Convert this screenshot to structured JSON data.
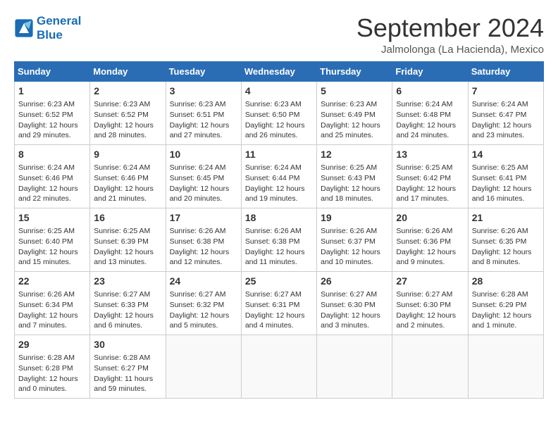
{
  "header": {
    "logo_line1": "General",
    "logo_line2": "Blue",
    "month": "September 2024",
    "location": "Jalmolonga (La Hacienda), Mexico"
  },
  "days_of_week": [
    "Sunday",
    "Monday",
    "Tuesday",
    "Wednesday",
    "Thursday",
    "Friday",
    "Saturday"
  ],
  "weeks": [
    [
      {
        "num": "1",
        "info": "Sunrise: 6:23 AM\nSunset: 6:52 PM\nDaylight: 12 hours\nand 29 minutes."
      },
      {
        "num": "2",
        "info": "Sunrise: 6:23 AM\nSunset: 6:52 PM\nDaylight: 12 hours\nand 28 minutes."
      },
      {
        "num": "3",
        "info": "Sunrise: 6:23 AM\nSunset: 6:51 PM\nDaylight: 12 hours\nand 27 minutes."
      },
      {
        "num": "4",
        "info": "Sunrise: 6:23 AM\nSunset: 6:50 PM\nDaylight: 12 hours\nand 26 minutes."
      },
      {
        "num": "5",
        "info": "Sunrise: 6:23 AM\nSunset: 6:49 PM\nDaylight: 12 hours\nand 25 minutes."
      },
      {
        "num": "6",
        "info": "Sunrise: 6:24 AM\nSunset: 6:48 PM\nDaylight: 12 hours\nand 24 minutes."
      },
      {
        "num": "7",
        "info": "Sunrise: 6:24 AM\nSunset: 6:47 PM\nDaylight: 12 hours\nand 23 minutes."
      }
    ],
    [
      {
        "num": "8",
        "info": "Sunrise: 6:24 AM\nSunset: 6:46 PM\nDaylight: 12 hours\nand 22 minutes."
      },
      {
        "num": "9",
        "info": "Sunrise: 6:24 AM\nSunset: 6:46 PM\nDaylight: 12 hours\nand 21 minutes."
      },
      {
        "num": "10",
        "info": "Sunrise: 6:24 AM\nSunset: 6:45 PM\nDaylight: 12 hours\nand 20 minutes."
      },
      {
        "num": "11",
        "info": "Sunrise: 6:24 AM\nSunset: 6:44 PM\nDaylight: 12 hours\nand 19 minutes."
      },
      {
        "num": "12",
        "info": "Sunrise: 6:25 AM\nSunset: 6:43 PM\nDaylight: 12 hours\nand 18 minutes."
      },
      {
        "num": "13",
        "info": "Sunrise: 6:25 AM\nSunset: 6:42 PM\nDaylight: 12 hours\nand 17 minutes."
      },
      {
        "num": "14",
        "info": "Sunrise: 6:25 AM\nSunset: 6:41 PM\nDaylight: 12 hours\nand 16 minutes."
      }
    ],
    [
      {
        "num": "15",
        "info": "Sunrise: 6:25 AM\nSunset: 6:40 PM\nDaylight: 12 hours\nand 15 minutes."
      },
      {
        "num": "16",
        "info": "Sunrise: 6:25 AM\nSunset: 6:39 PM\nDaylight: 12 hours\nand 13 minutes."
      },
      {
        "num": "17",
        "info": "Sunrise: 6:26 AM\nSunset: 6:38 PM\nDaylight: 12 hours\nand 12 minutes."
      },
      {
        "num": "18",
        "info": "Sunrise: 6:26 AM\nSunset: 6:38 PM\nDaylight: 12 hours\nand 11 minutes."
      },
      {
        "num": "19",
        "info": "Sunrise: 6:26 AM\nSunset: 6:37 PM\nDaylight: 12 hours\nand 10 minutes."
      },
      {
        "num": "20",
        "info": "Sunrise: 6:26 AM\nSunset: 6:36 PM\nDaylight: 12 hours\nand 9 minutes."
      },
      {
        "num": "21",
        "info": "Sunrise: 6:26 AM\nSunset: 6:35 PM\nDaylight: 12 hours\nand 8 minutes."
      }
    ],
    [
      {
        "num": "22",
        "info": "Sunrise: 6:26 AM\nSunset: 6:34 PM\nDaylight: 12 hours\nand 7 minutes."
      },
      {
        "num": "23",
        "info": "Sunrise: 6:27 AM\nSunset: 6:33 PM\nDaylight: 12 hours\nand 6 minutes."
      },
      {
        "num": "24",
        "info": "Sunrise: 6:27 AM\nSunset: 6:32 PM\nDaylight: 12 hours\nand 5 minutes."
      },
      {
        "num": "25",
        "info": "Sunrise: 6:27 AM\nSunset: 6:31 PM\nDaylight: 12 hours\nand 4 minutes."
      },
      {
        "num": "26",
        "info": "Sunrise: 6:27 AM\nSunset: 6:30 PM\nDaylight: 12 hours\nand 3 minutes."
      },
      {
        "num": "27",
        "info": "Sunrise: 6:27 AM\nSunset: 6:30 PM\nDaylight: 12 hours\nand 2 minutes."
      },
      {
        "num": "28",
        "info": "Sunrise: 6:28 AM\nSunset: 6:29 PM\nDaylight: 12 hours\nand 1 minute."
      }
    ],
    [
      {
        "num": "29",
        "info": "Sunrise: 6:28 AM\nSunset: 6:28 PM\nDaylight: 12 hours\nand 0 minutes."
      },
      {
        "num": "30",
        "info": "Sunrise: 6:28 AM\nSunset: 6:27 PM\nDaylight: 11 hours\nand 59 minutes."
      },
      null,
      null,
      null,
      null,
      null
    ]
  ]
}
